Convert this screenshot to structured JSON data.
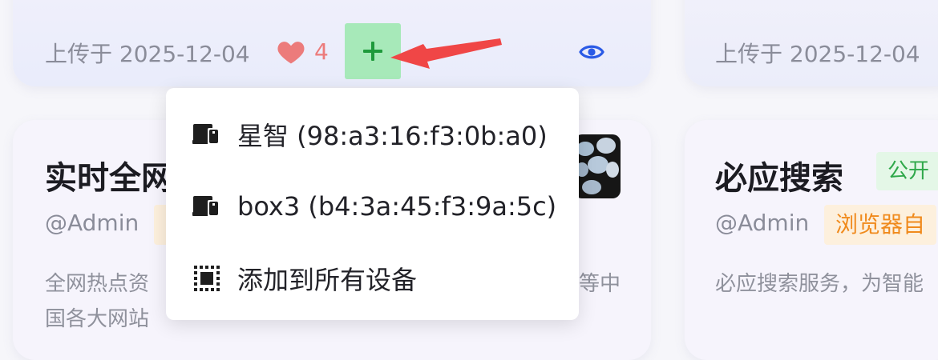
{
  "cards": {
    "top_left": {
      "date": "上传于 2025-12-04",
      "likes": "4"
    },
    "top_right": {
      "date": "上传于 2025-12-04"
    },
    "bottom_left": {
      "title": "实时全网",
      "author": "@Admin",
      "desc_line1_left": "全网热点资",
      "desc_line1_right": "等中",
      "desc_line2": "国各大网站"
    },
    "bottom_right": {
      "title": "必应搜索",
      "tag_public": "公开",
      "author": "@Admin",
      "tag_browser": "浏览器自",
      "desc": "必应搜索服务，为智能"
    }
  },
  "dropdown": {
    "items": [
      {
        "label": "星智 (98:a3:16:f3:0b:a0)",
        "icon": "devices-icon"
      },
      {
        "label": "box3 (b4:3a:45:f3:9a:5c)",
        "icon": "devices-icon"
      },
      {
        "label": "添加到所有设备",
        "icon": "select-all-icon"
      }
    ]
  },
  "colors": {
    "accent_blue": "#2b5be6",
    "like_red": "#ec7b7b",
    "add_green_bg": "#a7e9b9",
    "add_green_fg": "#1f9a3c",
    "arrow_red": "#f04646"
  }
}
